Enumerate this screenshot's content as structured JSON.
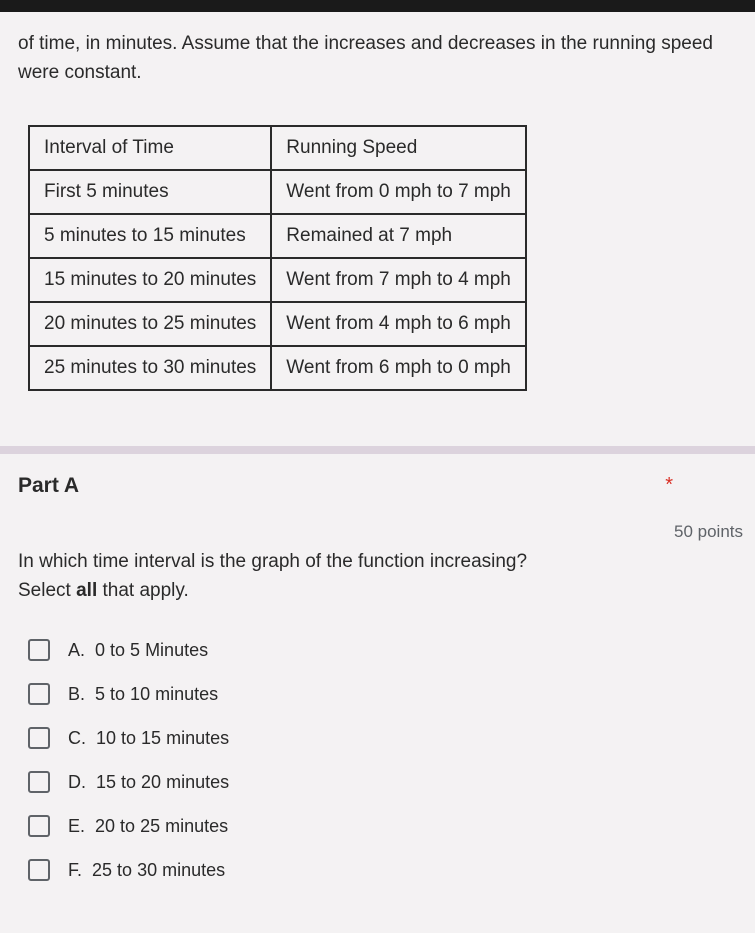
{
  "intro_text": "of time, in minutes. Assume that the increases and decreases in the running speed were constant.",
  "table": {
    "headers": [
      "Interval of Time",
      "Running Speed"
    ],
    "rows": [
      [
        "First 5 minutes",
        "Went from 0 mph to 7 mph"
      ],
      [
        "5 minutes to 15 minutes",
        "Remained at 7 mph"
      ],
      [
        "15 minutes to 20 minutes",
        "Went from 7 mph to 4 mph"
      ],
      [
        "20 minutes to 25 minutes",
        "Went from 4 mph to 6 mph"
      ],
      [
        "25 minutes to 30 minutes",
        "Went from 6 mph to 0 mph"
      ]
    ]
  },
  "part": {
    "label": "Part A",
    "required_mark": "*",
    "points": "50 points",
    "prompt_line1": "In which time interval is the graph of the function increasing?",
    "prompt_line2": "Select all that apply."
  },
  "options": [
    {
      "letter": "A.",
      "text": "0 to 5 Minutes"
    },
    {
      "letter": "B.",
      "text": "5 to 10 minutes"
    },
    {
      "letter": "C.",
      "text": "10 to 15 minutes"
    },
    {
      "letter": "D.",
      "text": "15 to 20 minutes"
    },
    {
      "letter": "E.",
      "text": "20 to 25 minutes"
    },
    {
      "letter": "F.",
      "text": "25 to 30 minutes"
    }
  ]
}
